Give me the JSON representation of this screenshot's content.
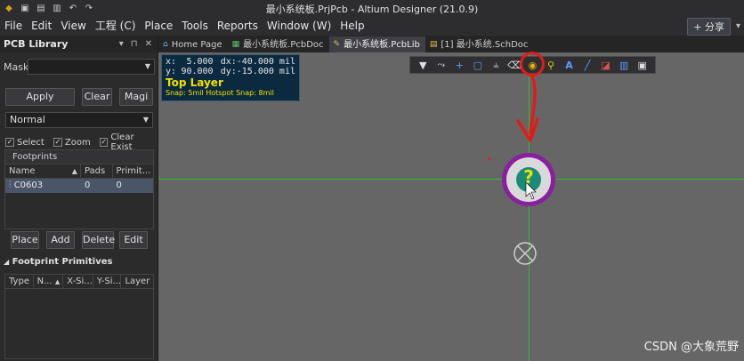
{
  "window": {
    "title": "最小系统板.PrjPcb - Altium Designer (21.0.9)"
  },
  "menu": {
    "items": [
      "File",
      "Edit",
      "View",
      "工程 (C)",
      "Place",
      "Tools",
      "Reports",
      "Window (W)",
      "Help"
    ],
    "share_label": "分享"
  },
  "panel": {
    "title": "PCB Library",
    "mask_label": "Mask",
    "mask_value": "",
    "buttons": {
      "apply": "Apply",
      "clear": "Clear",
      "magnify": "Magi"
    },
    "mode": "Normal",
    "checks": [
      {
        "label": "Select",
        "checked": true
      },
      {
        "label": "Zoom",
        "checked": true
      },
      {
        "label": "Clear Exist",
        "checked": true
      }
    ],
    "footprints": {
      "title": "Footprints",
      "columns": [
        "Name",
        "Pads",
        "Primit..."
      ],
      "rows": [
        {
          "name": "C0603",
          "pads": "0",
          "primitives": "0"
        }
      ]
    },
    "actions": {
      "place": "Place",
      "add": "Add",
      "delete": "Delete",
      "edit": "Edit"
    },
    "primitives": {
      "title": "Footprint Primitives",
      "columns": [
        "Type",
        "N...",
        "X-Si...",
        "Y-Si...",
        "Layer"
      ]
    }
  },
  "tabs": [
    {
      "label": "Home Page",
      "icon": "home-icon",
      "active": false
    },
    {
      "label": "最小系统板.PcbDoc",
      "icon": "pcb-doc-icon",
      "active": false
    },
    {
      "label": "最小系统板.PcbLib",
      "icon": "pcb-lib-icon",
      "active": true
    },
    {
      "label": "[1] 最小系统.SchDoc",
      "icon": "sch-doc-icon",
      "active": false
    }
  ],
  "hud": {
    "x_label": "x:",
    "x_value": "5.000",
    "dx_label": "dx:",
    "dx_value": "-40.000 mil",
    "y_label": "y:",
    "y_value": "90.000",
    "dy_label": "dy:",
    "dy_value": "-15.000 mil",
    "layer": "Top Layer",
    "snap": "Snap: 5mil Hotspot Snap: 8mil"
  },
  "toolbar": {
    "tools": [
      "filter-icon",
      "route-icon",
      "cross-icon",
      "select-rect-icon",
      "align-icon",
      "eraser-icon",
      "pad-icon",
      "via-icon",
      "text-icon",
      "line-icon",
      "rect-fill-icon",
      "chart-icon",
      "region-icon"
    ]
  },
  "canvas": {
    "pad_label": "?"
  },
  "watermark": "CSDN @大象荒野",
  "colors": {
    "canvas_bg": "#666666",
    "axis_green": "#2bbf2b",
    "pad_outer": "#8a1fa0",
    "pad_inner": "#1a8a7a",
    "annotation_red": "#e31a1a",
    "layer_yellow": "#f0e000"
  }
}
